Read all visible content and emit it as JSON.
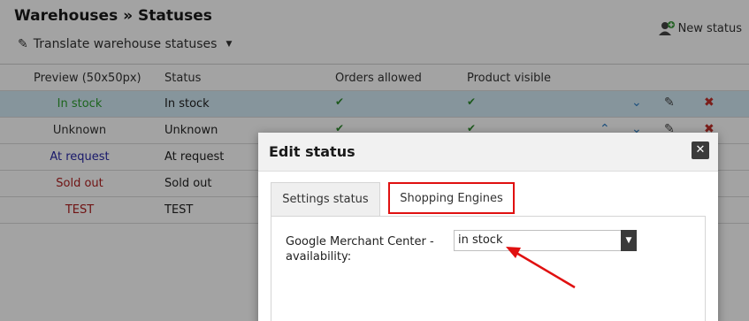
{
  "page": {
    "title": "Warehouses » Statuses",
    "translate_label": "Translate warehouse statuses",
    "new_status_label": "New status",
    "columns": [
      "Preview (50x50px)",
      "Status",
      "Orders allowed",
      "Product visible"
    ],
    "rows": [
      {
        "preview": "In stock",
        "status": "In stock",
        "color": "#2e9e2e"
      },
      {
        "preview": "Unknown",
        "status": "Unknown",
        "color": "#333333"
      },
      {
        "preview": "At request",
        "status": "At request",
        "color": "#2a2aa8"
      },
      {
        "preview": "Sold out",
        "status": "Sold out",
        "color": "#b02020"
      },
      {
        "preview": "TEST",
        "status": "TEST",
        "color": "#b02020"
      }
    ]
  },
  "modal": {
    "title": "Edit status",
    "close_icon": "close-icon",
    "tabs": [
      {
        "label": "Settings status",
        "active": false
      },
      {
        "label": "Shopping Engines",
        "active": true
      }
    ],
    "field": {
      "label": "Google Merchant Center - availability:",
      "value": "in stock"
    }
  },
  "annotation": {
    "highlight_color": "#e01010"
  }
}
